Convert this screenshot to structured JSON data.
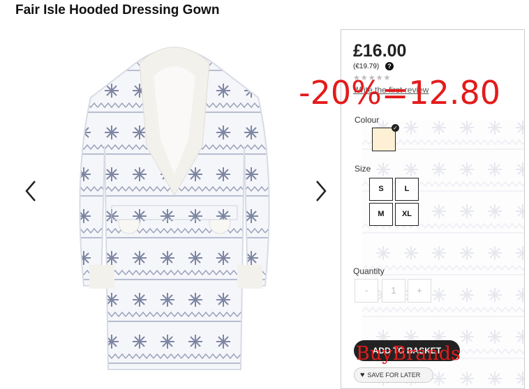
{
  "product": {
    "title": "Fair Isle Hooded Dressing Gown",
    "price": "£16.00",
    "price_eur": "(€19.79)",
    "help_icon": "?",
    "stars": "★★★★★",
    "review_link": "Write the first review"
  },
  "options": {
    "colour_label": "Colour",
    "selected_colour": "#fdf0d5",
    "size_label": "Size",
    "sizes": [
      "S",
      "L",
      "M",
      "XL"
    ],
    "quantity_label": "Quantity",
    "qty_minus": "-",
    "qty_value": "1",
    "qty_plus": "+"
  },
  "actions": {
    "add_to_basket": "ADD TO BASKET",
    "save_for_later": "SAVE FOR LATER"
  },
  "overlay": {
    "discount_text": "-20%=12.80",
    "watermark": "BuyBrands"
  },
  "colors": {
    "accent_red": "#e31b1b",
    "button_dark": "#222222"
  }
}
